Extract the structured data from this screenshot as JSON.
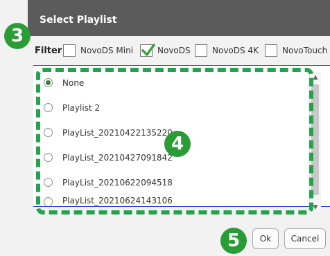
{
  "dialog": {
    "title": "Select Playlist",
    "filter_label": "Filter",
    "filters": [
      {
        "label": "NovoDS Mini",
        "checked": false
      },
      {
        "label": "NovoDS",
        "checked": true
      },
      {
        "label": "NovoDS 4K",
        "checked": false
      },
      {
        "label": "NovoTouch",
        "checked": false
      }
    ],
    "playlists": [
      {
        "label": "None",
        "selected": true
      },
      {
        "label": "Playlist 2",
        "selected": false
      },
      {
        "label": "PlayList_20210422135220",
        "selected": false
      },
      {
        "label": "PlayList_20210427091842",
        "selected": false
      },
      {
        "label": "PlayList_20210622094518",
        "selected": false
      },
      {
        "label": "PlayList_20210624143106",
        "selected": false
      }
    ],
    "ok_label": "Ok",
    "cancel_label": "Cancel"
  },
  "scrollbar": {
    "up_icon": "chevron-up-icon",
    "down_icon": "chevron-down-icon"
  },
  "annotations": {
    "step3": "3",
    "step4": "4",
    "step5": "5"
  },
  "colors": {
    "titlebar": "#5b5b5b",
    "annotation_green": "#2a9c35",
    "checkbox_green": "#3aa33a",
    "list_border_blue": "#1f3fcf"
  }
}
